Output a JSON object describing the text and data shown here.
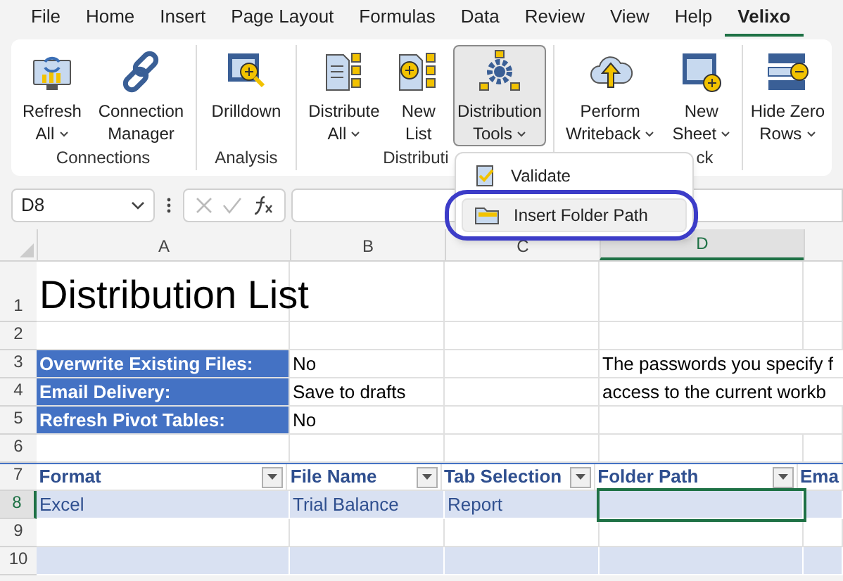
{
  "menu_tabs": [
    {
      "label": "File",
      "selected": false
    },
    {
      "label": "Home",
      "selected": false
    },
    {
      "label": "Insert",
      "selected": false
    },
    {
      "label": "Page Layout",
      "selected": false
    },
    {
      "label": "Formulas",
      "selected": false
    },
    {
      "label": "Data",
      "selected": false
    },
    {
      "label": "Review",
      "selected": false
    },
    {
      "label": "View",
      "selected": false
    },
    {
      "label": "Help",
      "selected": false
    },
    {
      "label": "Velixo",
      "selected": true
    }
  ],
  "ribbon_groups": [
    {
      "label": "Connections",
      "buttons": [
        {
          "lines": [
            "Refresh",
            "All"
          ],
          "dropdown": true,
          "selected": false
        },
        {
          "lines": [
            "Connection",
            "Manager"
          ],
          "dropdown": false,
          "selected": false
        }
      ]
    },
    {
      "label": "Analysis",
      "buttons": [
        {
          "lines": [
            "Drilldown"
          ],
          "dropdown": false,
          "selected": false
        }
      ]
    },
    {
      "label": "Distributi",
      "buttons": [
        {
          "lines": [
            "Distribute",
            "All"
          ],
          "dropdown": true,
          "selected": false
        },
        {
          "lines": [
            "New",
            "List"
          ],
          "dropdown": false,
          "selected": false
        },
        {
          "lines": [
            "Distribution",
            "Tools"
          ],
          "dropdown": true,
          "selected": true
        }
      ]
    },
    {
      "label": "ck",
      "buttons": [
        {
          "lines": [
            "Perform",
            "Writeback"
          ],
          "dropdown": true,
          "selected": false
        },
        {
          "lines": [
            "New",
            "Sheet"
          ],
          "dropdown": true,
          "selected": false
        }
      ]
    },
    {
      "buttons": [
        {
          "lines": [
            "Hide Zero",
            "Rows"
          ],
          "dropdown": true,
          "selected": false
        }
      ]
    }
  ],
  "dropdown_menu": [
    {
      "label": "Validate",
      "selected": false
    },
    {
      "label": "Insert Folder Path",
      "selected": true
    }
  ],
  "name_box": "D8",
  "columns": [
    {
      "label": "A",
      "selected": false
    },
    {
      "label": "B",
      "selected": false
    },
    {
      "label": "C",
      "selected": false
    },
    {
      "label": "D",
      "selected": true
    }
  ],
  "rows": [
    {
      "number": "1",
      "selected": false,
      "kind": "title",
      "cells": [
        "Distribution List"
      ]
    },
    {
      "number": "2",
      "selected": false,
      "kind": "blank",
      "cells": []
    },
    {
      "number": "3",
      "selected": false,
      "kind": "setting",
      "cells": [
        "Overwrite Existing Files:",
        "No",
        "",
        "The passwords you specify f"
      ]
    },
    {
      "number": "4",
      "selected": false,
      "kind": "setting",
      "cells": [
        "Email Delivery:",
        "Save to drafts",
        "",
        "access to the current workb"
      ]
    },
    {
      "number": "5",
      "selected": false,
      "kind": "setting",
      "cells": [
        "Refresh Pivot Tables:",
        "No"
      ]
    },
    {
      "number": "6",
      "selected": false,
      "kind": "blank",
      "cells": []
    },
    {
      "number": "7",
      "selected": false,
      "kind": "header",
      "cells": [
        "Format",
        "File Name",
        "Tab Selection",
        "Folder Path",
        "Ema"
      ]
    },
    {
      "number": "8",
      "selected": true,
      "kind": "band",
      "cells": [
        "Excel",
        "Trial Balance",
        "Report"
      ]
    },
    {
      "number": "9",
      "selected": false,
      "kind": "blank",
      "cells": []
    },
    {
      "number": "10",
      "selected": false,
      "kind": "band",
      "cells": []
    }
  ]
}
